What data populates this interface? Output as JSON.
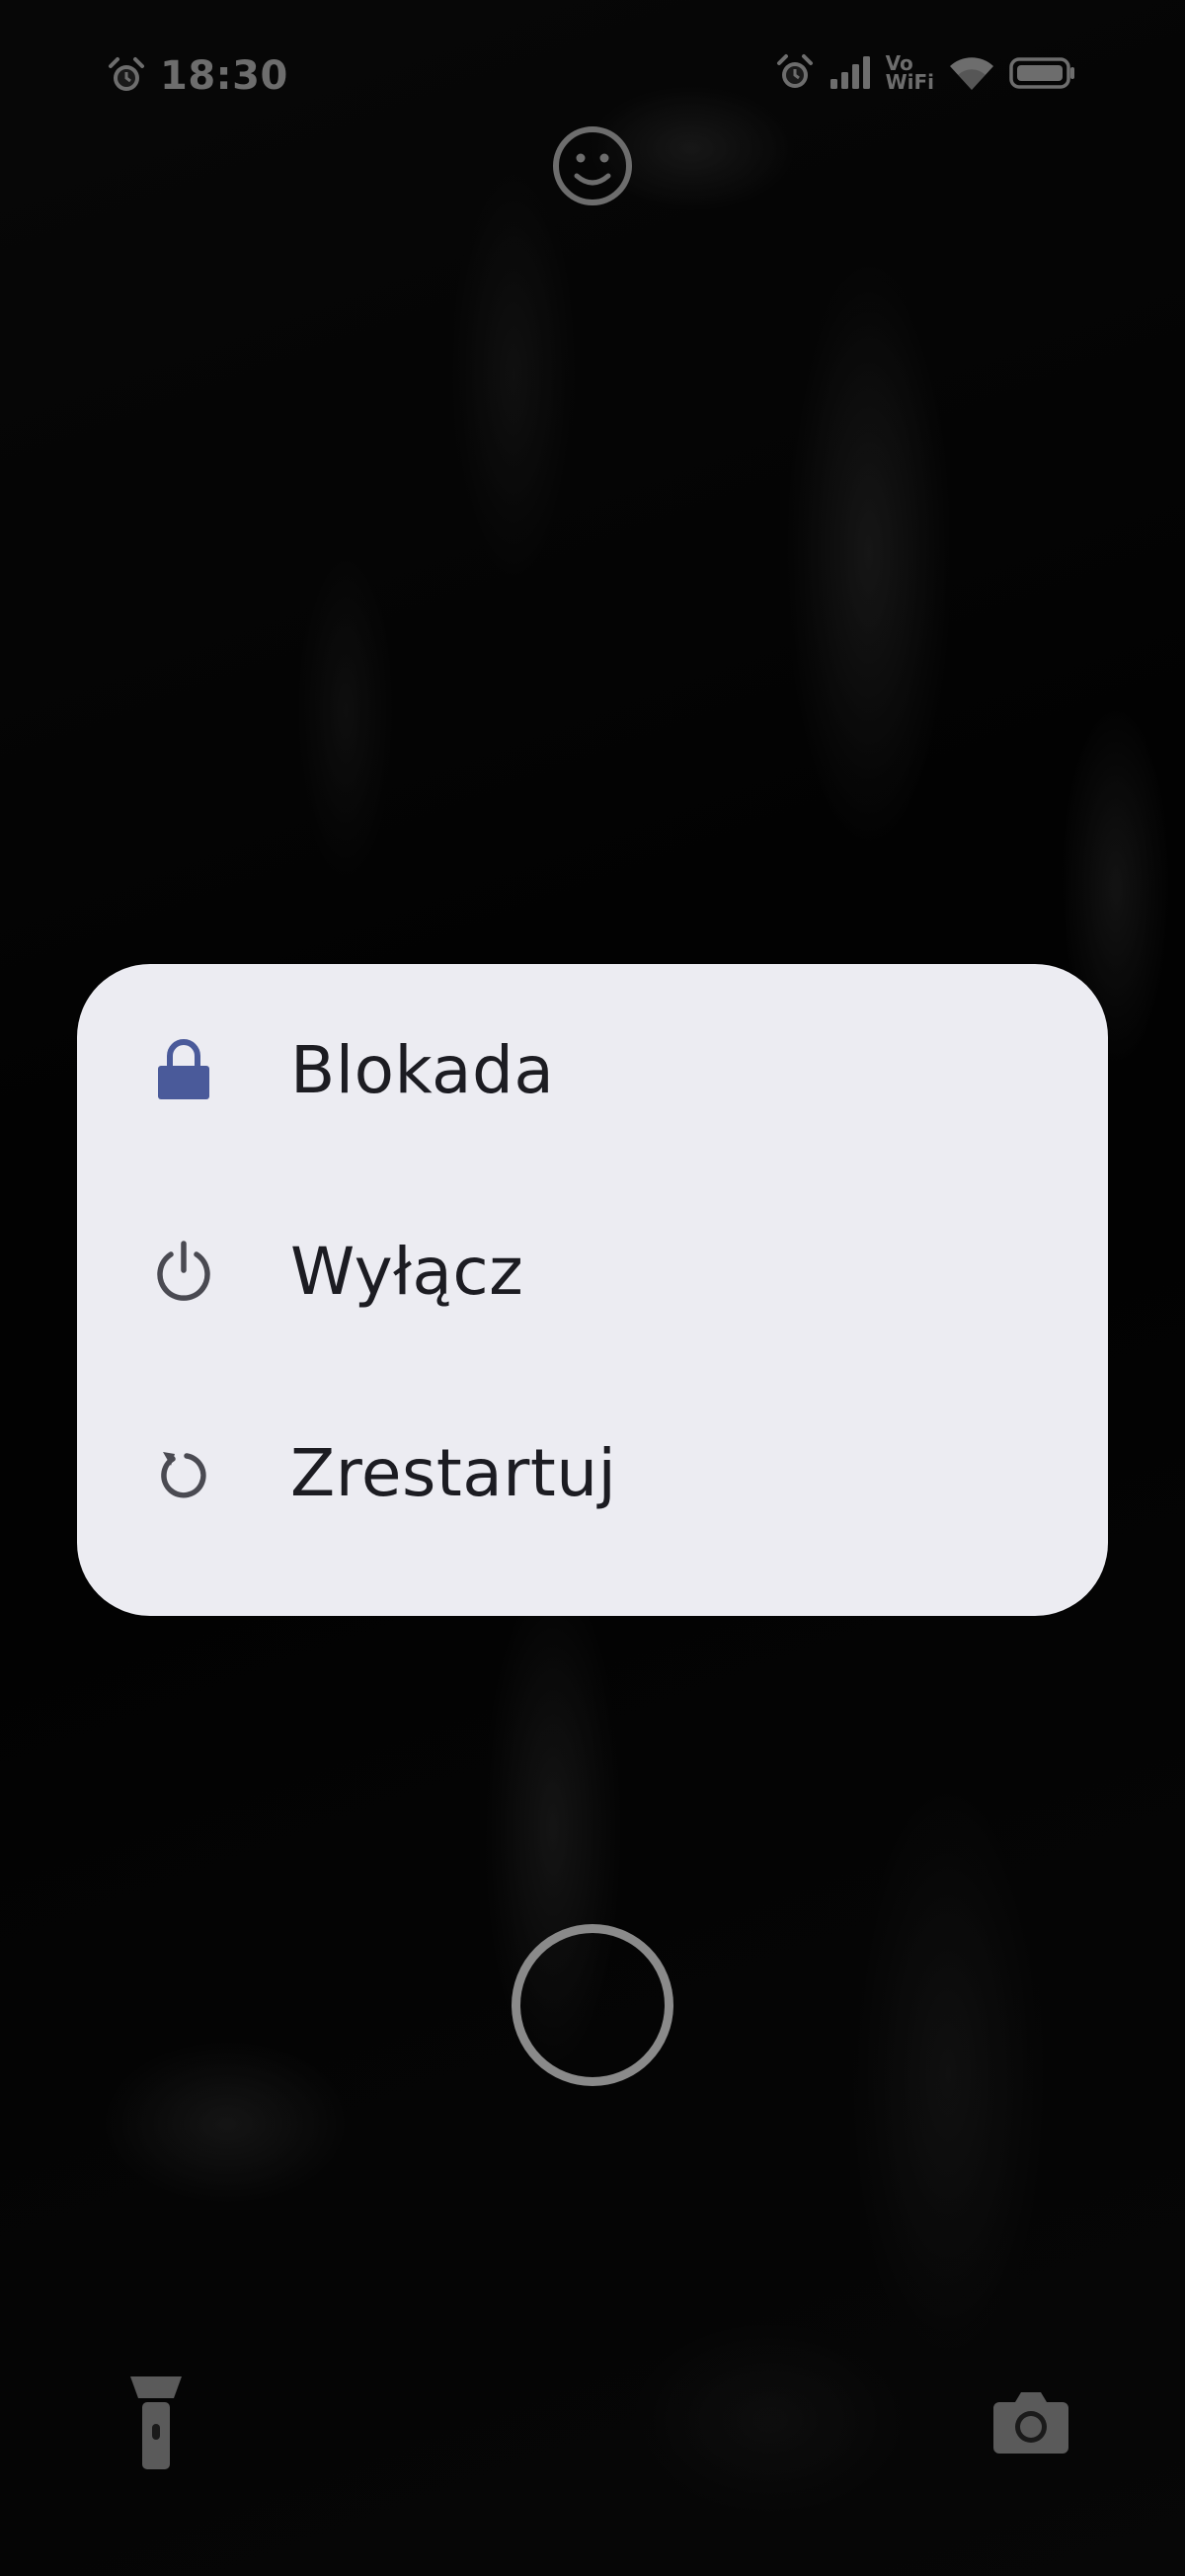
{
  "status_bar": {
    "time": "18:30",
    "vowifi_line1": "Vo",
    "vowifi_line2": "WiFi",
    "icons": [
      "alarm-icon",
      "alarm-icon",
      "signal-icon",
      "vowifi-icon",
      "wifi-icon",
      "battery-icon"
    ]
  },
  "power_menu": {
    "items": [
      {
        "label": "Blokada",
        "icon": "lock-icon"
      },
      {
        "label": "Wyłącz",
        "icon": "power-icon"
      },
      {
        "label": "Zrestartuj",
        "icon": "restart-icon"
      }
    ]
  },
  "colors": {
    "menu_background": "#ececf2",
    "accent_lock": "#4a5a9a",
    "text": "#1c1c22",
    "icon_grey": "#4a4a52"
  }
}
